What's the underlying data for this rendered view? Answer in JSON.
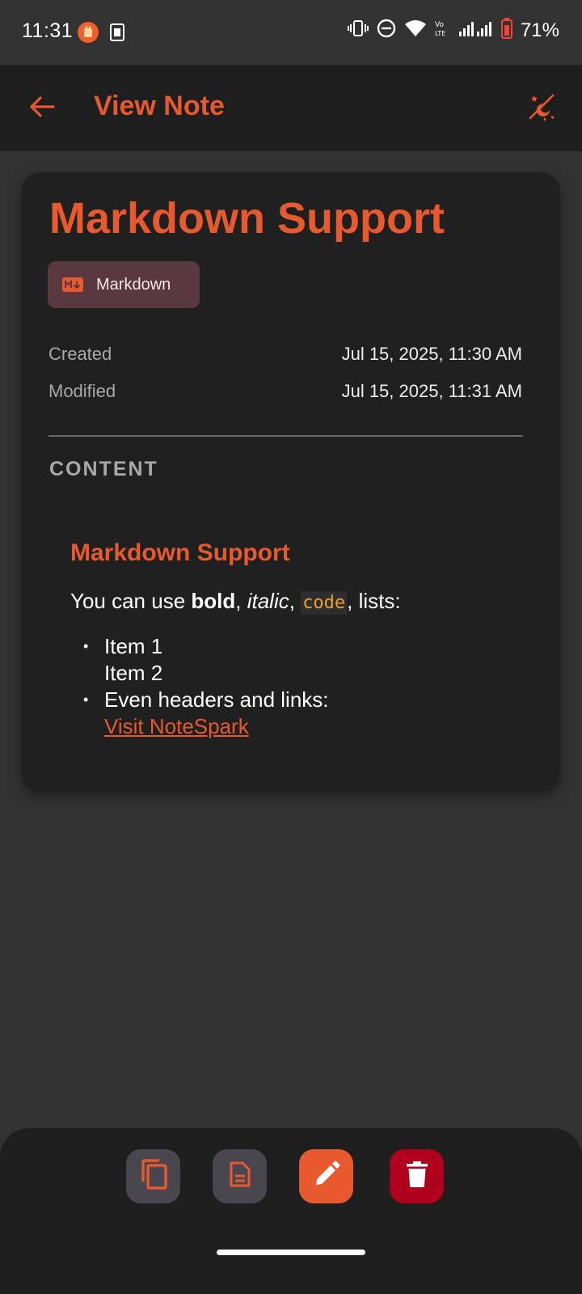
{
  "status_bar": {
    "time": "11:31",
    "battery_percent": "71%",
    "icons": [
      "notification-app-icon",
      "sim-card-icon",
      "vibrate-icon",
      "do-not-disturb-icon",
      "wifi-icon",
      "volte-icon",
      "signal-icon",
      "signal-icon",
      "battery-icon"
    ]
  },
  "app_bar": {
    "title": "View Note",
    "accent_color": "#e85a2e"
  },
  "note": {
    "title": "Markdown Support",
    "format_chip": "Markdown",
    "meta": [
      {
        "label": "Created",
        "value": "Jul 15, 2025, 11:30 AM"
      },
      {
        "label": "Modified",
        "value": "Jul 15, 2025, 11:31 AM"
      }
    ],
    "content_label": "CONTENT",
    "content": {
      "heading": "Markdown Support",
      "paragraph": {
        "prefix": "You can use ",
        "bold": "bold",
        "sep1": ", ",
        "italic": "italic",
        "sep2": ", ",
        "code": "code",
        "suffix": ", lists:"
      },
      "list": {
        "item1_line1": "Item 1",
        "item1_line2": "Item 2",
        "item2": "Even headers and links:",
        "link_text": "Visit NoteSpark"
      }
    }
  },
  "bottom_actions": [
    {
      "name": "copy",
      "icon": "copy-icon"
    },
    {
      "name": "export",
      "icon": "document-icon"
    },
    {
      "name": "edit",
      "icon": "pencil-icon"
    },
    {
      "name": "delete",
      "icon": "trash-icon"
    }
  ],
  "colors": {
    "accent": "#e85a2e",
    "delete": "#b0001e",
    "secondary_button": "#4a4650",
    "chip_bg": "#5a3840",
    "code_text": "#e8a02e"
  }
}
